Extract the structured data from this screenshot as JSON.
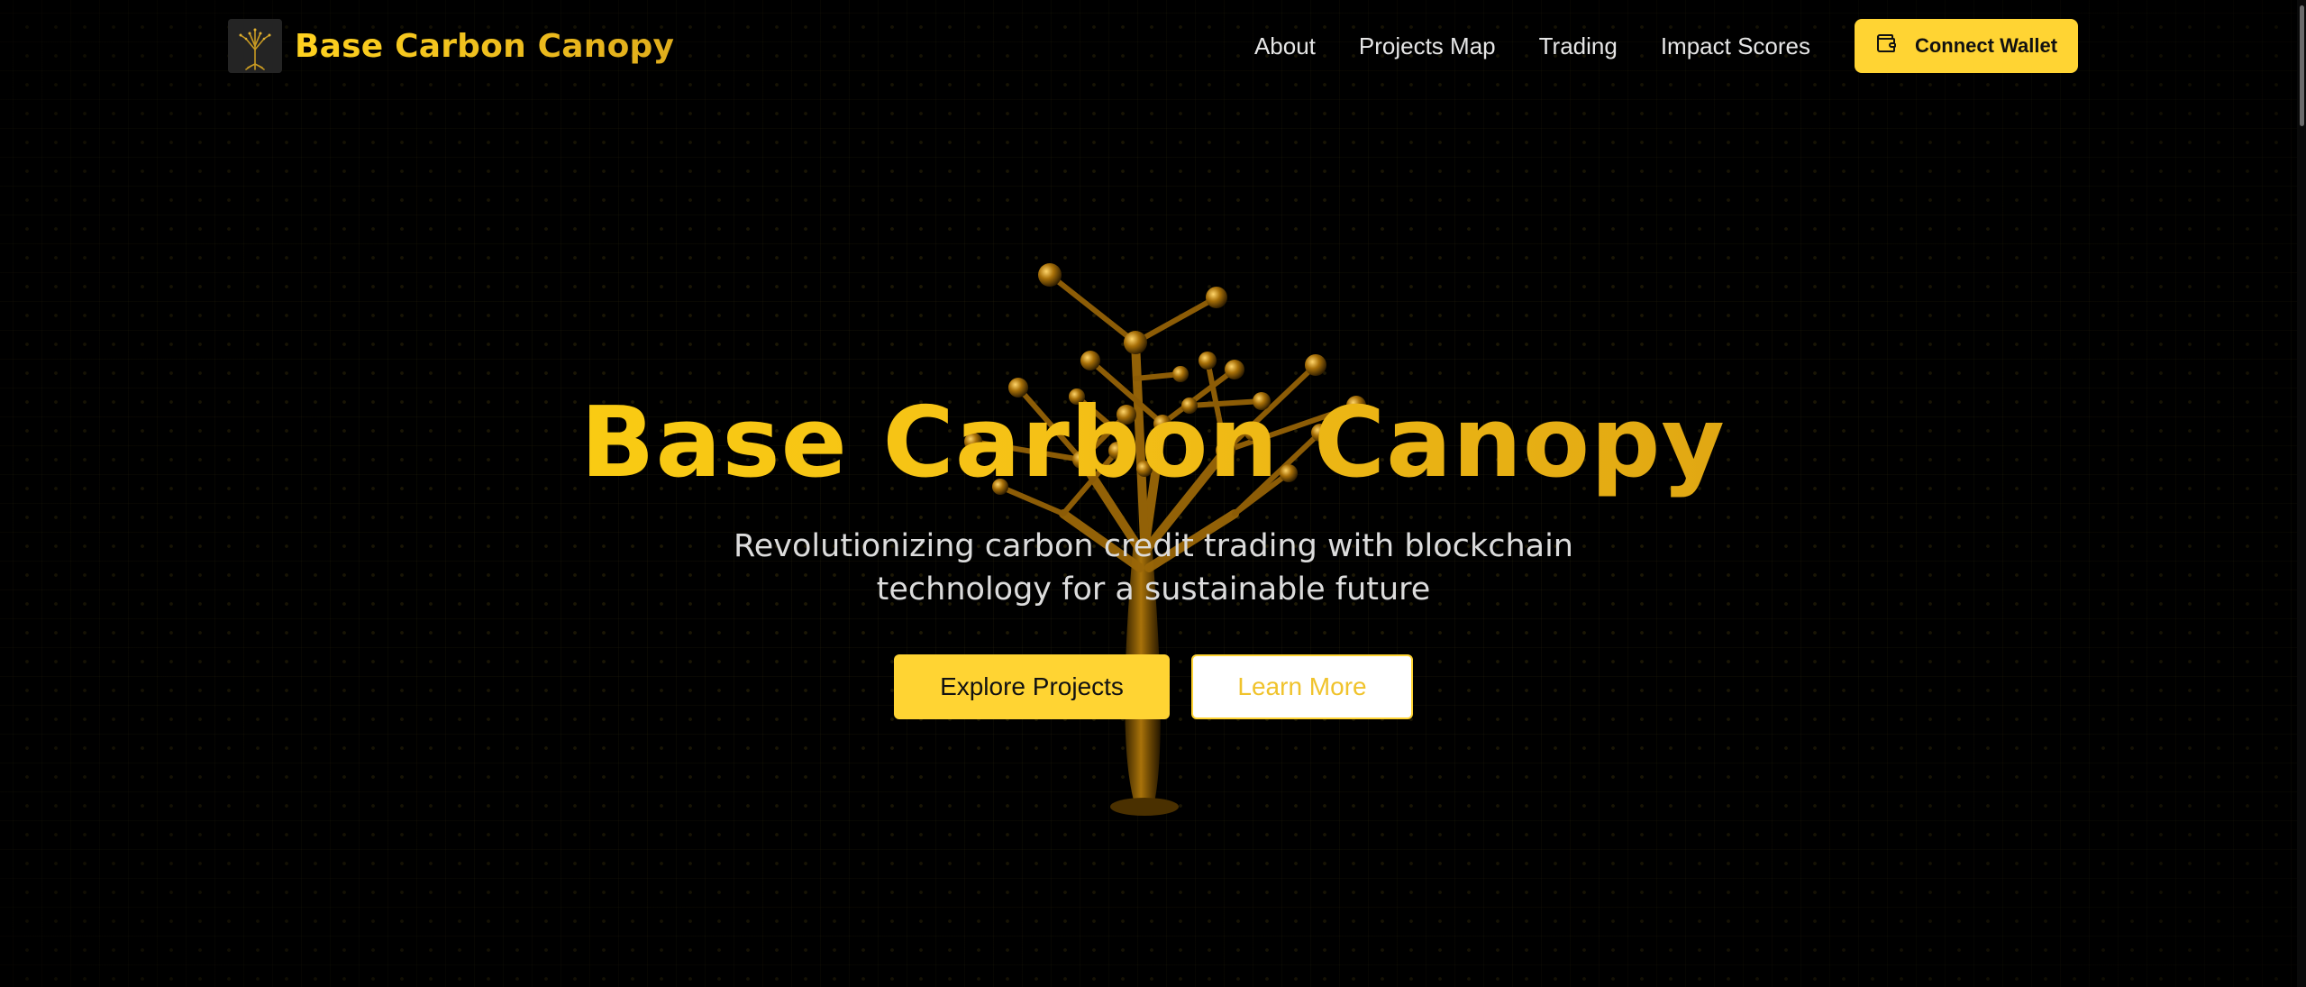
{
  "header": {
    "brand_name": "Base Carbon Canopy",
    "logo_icon": "tree-logo-icon",
    "nav": [
      {
        "label": "About"
      },
      {
        "label": "Projects Map"
      },
      {
        "label": "Trading"
      },
      {
        "label": "Impact Scores"
      }
    ],
    "connect_wallet": {
      "label": "Connect Wallet",
      "icon": "wallet-icon"
    }
  },
  "hero": {
    "title": "Base Carbon Canopy",
    "subtitle": "Revolutionizing carbon credit trading with blockchain technology for a sustainable future",
    "primary_button": "Explore Projects",
    "secondary_button": "Learn More",
    "illustration": "3d-golden-tree-icon"
  },
  "colors": {
    "background": "#000000",
    "accent": "#ffd433",
    "accent_dark": "#cf9210",
    "text": "#dcdcdc"
  }
}
